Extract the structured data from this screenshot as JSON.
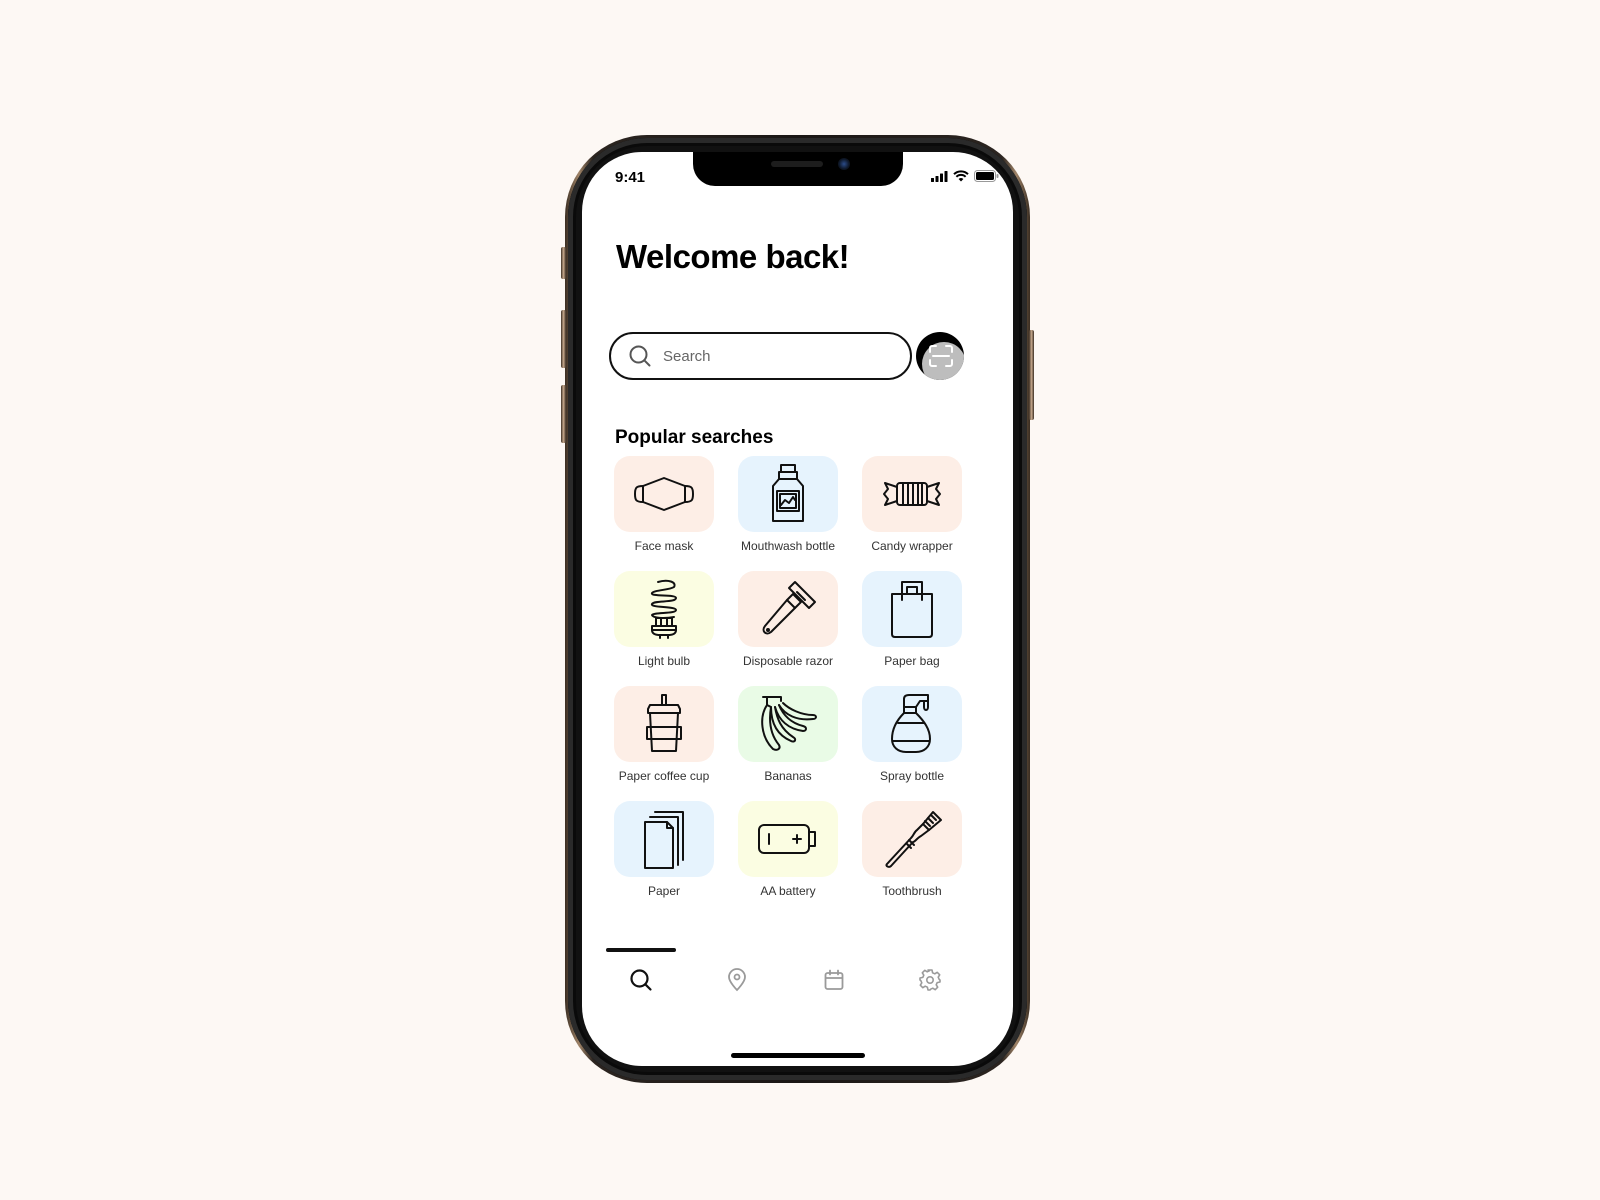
{
  "status_bar": {
    "time": "9:41",
    "icons": [
      "signal-icon",
      "wifi-icon",
      "battery-icon"
    ]
  },
  "header": {
    "title": "Welcome back!"
  },
  "search": {
    "placeholder": "Search",
    "value": "",
    "icon": "search-icon",
    "scan_button_icon": "scan-icon"
  },
  "popular": {
    "title": "Popular searches",
    "items": [
      {
        "label": "Face mask",
        "icon": "face-mask-icon",
        "bg": "#fdeee6"
      },
      {
        "label": "Mouthwash bottle",
        "icon": "mouthwash-bottle-icon",
        "bg": "#e6f3fd"
      },
      {
        "label": "Candy wrapper",
        "icon": "candy-icon",
        "bg": "#fdeee6"
      },
      {
        "label": "Light bulb",
        "icon": "light-bulb-icon",
        "bg": "#fbfde2"
      },
      {
        "label": "Disposable razor",
        "icon": "razor-icon",
        "bg": "#fdeee6"
      },
      {
        "label": "Paper bag",
        "icon": "paper-bag-icon",
        "bg": "#e6f3fd"
      },
      {
        "label": "Paper coffee cup",
        "icon": "coffee-cup-icon",
        "bg": "#fdeee6"
      },
      {
        "label": "Bananas",
        "icon": "bananas-icon",
        "bg": "#e9fbe6"
      },
      {
        "label": "Spray bottle",
        "icon": "spray-bottle-icon",
        "bg": "#e6f3fd"
      },
      {
        "label": "Paper",
        "icon": "paper-icon",
        "bg": "#e6f3fd"
      },
      {
        "label": "AA battery",
        "icon": "battery-aa-icon",
        "bg": "#fbfde2"
      },
      {
        "label": "Toothbrush",
        "icon": "toothbrush-icon",
        "bg": "#fdeee6"
      }
    ]
  },
  "tabbar": {
    "active_index": 0,
    "tabs": [
      {
        "name": "search",
        "icon": "search-icon",
        "color": "#111111"
      },
      {
        "name": "location",
        "icon": "location-pin-icon",
        "color": "#9a9a9a"
      },
      {
        "name": "calendar",
        "icon": "calendar-icon",
        "color": "#9a9a9a"
      },
      {
        "name": "settings",
        "icon": "gear-icon",
        "color": "#9a9a9a"
      }
    ]
  }
}
